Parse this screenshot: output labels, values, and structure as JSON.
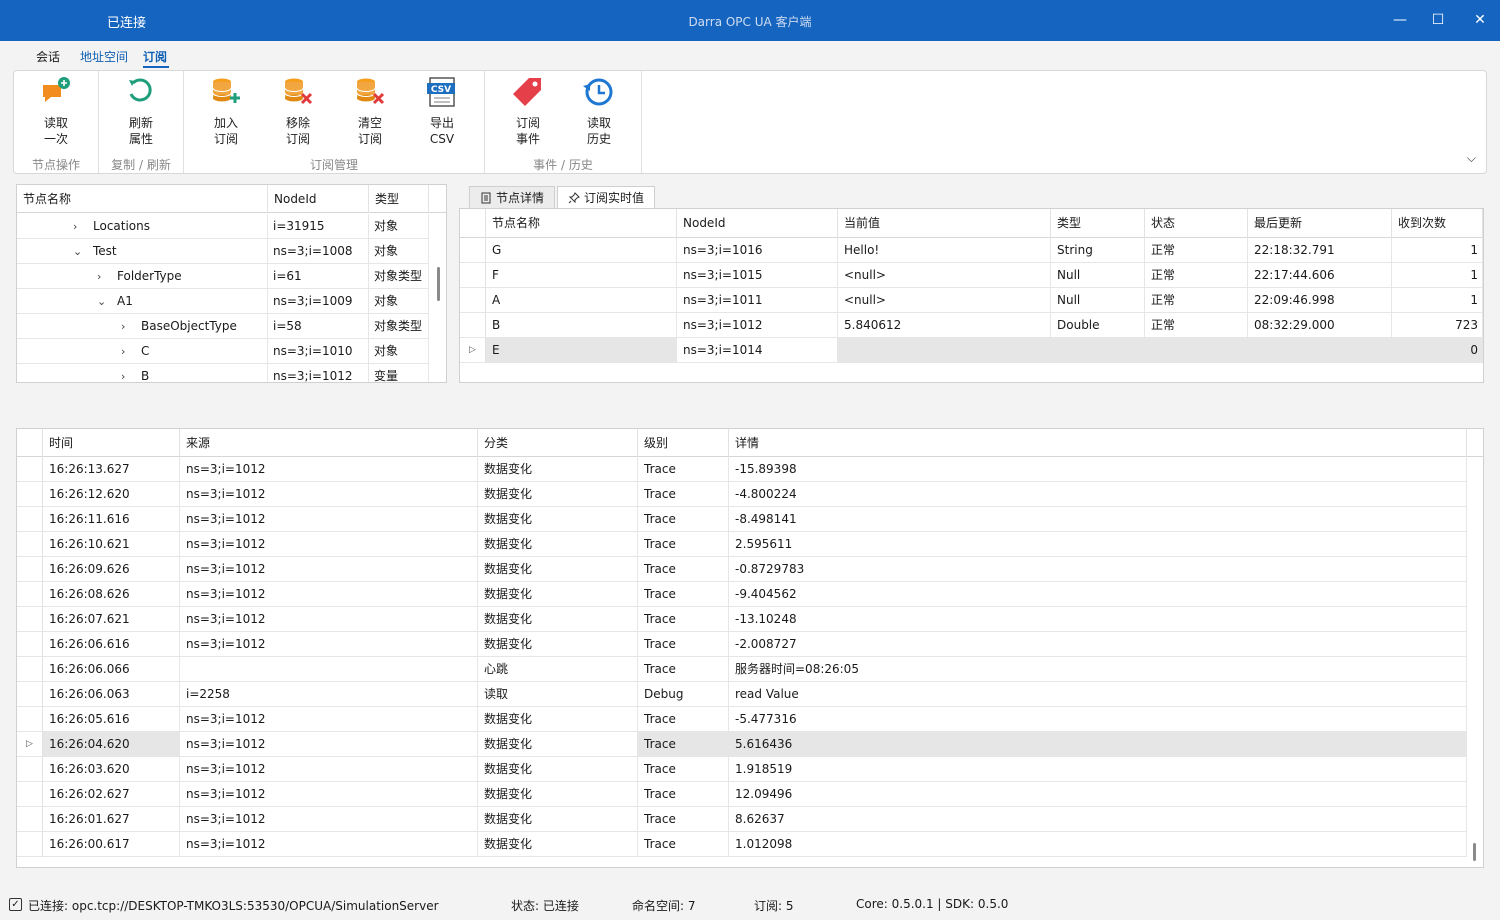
{
  "window": {
    "connection_label": "已连接",
    "title": "Darra OPC UA 客户端",
    "minimize_glyph": "—",
    "maximize_glyph": "☐",
    "close_glyph": "✕"
  },
  "ribbon_tabs": [
    "会话",
    "地址空间",
    "订阅"
  ],
  "ribbon": {
    "buttons": [
      {
        "line1": "读取",
        "line2": "一次",
        "icon": "read-once-icon"
      },
      {
        "line1": "刷新",
        "line2": "属性",
        "icon": "refresh-icon"
      },
      {
        "line1": "加入",
        "line2": "订阅",
        "icon": "db-add-icon"
      },
      {
        "line1": "移除",
        "line2": "订阅",
        "icon": "db-remove-icon"
      },
      {
        "line1": "清空",
        "line2": "订阅",
        "icon": "db-clear-icon"
      },
      {
        "line1": "导出",
        "line2": "CSV",
        "icon": "csv-icon"
      },
      {
        "line1": "订阅",
        "line2": "事件",
        "icon": "tag-icon"
      },
      {
        "line1": "读取",
        "line2": "历史",
        "icon": "history-icon"
      }
    ],
    "groups": [
      "节点操作",
      "复制 / 刷新",
      "订阅管理",
      "事件 / 历史"
    ],
    "collapse_glyph": "⌵"
  },
  "tree": {
    "headers": [
      "节点名称",
      "NodeId",
      "类型"
    ],
    "rows": [
      {
        "name": "Locations",
        "nodeid": "i=31915",
        "type": "对象",
        "toggle": "›"
      },
      {
        "name": "Test",
        "nodeid": "ns=3;i=1008",
        "type": "对象",
        "toggle": "⌄"
      },
      {
        "name": "FolderType",
        "nodeid": "i=61",
        "type": "对象类型",
        "toggle": "›"
      },
      {
        "name": "A1",
        "nodeid": "ns=3;i=1009",
        "type": "对象",
        "toggle": "⌄"
      },
      {
        "name": "BaseObjectType",
        "nodeid": "i=58",
        "type": "对象类型",
        "toggle": "›"
      },
      {
        "name": "C",
        "nodeid": "ns=3;i=1010",
        "type": "对象",
        "toggle": "›"
      },
      {
        "name": "B",
        "nodeid": "ns=3;i=1012",
        "type": "变量",
        "toggle": "›"
      }
    ]
  },
  "panel_tabs": [
    "节点详情",
    "订阅实时值"
  ],
  "subscriptions": {
    "headers": [
      "节点名称",
      "NodeId",
      "当前值",
      "类型",
      "状态",
      "最后更新",
      "收到次数"
    ],
    "rows": [
      {
        "name": "G",
        "nodeid": "ns=3;i=1016",
        "value": "Hello!",
        "type": "String",
        "status": "正常",
        "updated": "22:18:32.791",
        "count": "1"
      },
      {
        "name": "F",
        "nodeid": "ns=3;i=1015",
        "value": "<null>",
        "type": "Null",
        "status": "正常",
        "updated": "22:17:44.606",
        "count": "1"
      },
      {
        "name": "A",
        "nodeid": "ns=3;i=1011",
        "value": "<null>",
        "type": "Null",
        "status": "正常",
        "updated": "22:09:46.998",
        "count": "1"
      },
      {
        "name": "B",
        "nodeid": "ns=3;i=1012",
        "value": "5.840612",
        "type": "Double",
        "status": "正常",
        "updated": "08:32:29.000",
        "count": "723"
      },
      {
        "name": "E",
        "nodeid": "ns=3;i=1014",
        "value": "",
        "type": "",
        "status": "",
        "updated": "",
        "count": "0"
      }
    ],
    "row_marker": "▷"
  },
  "log": {
    "headers": [
      "时间",
      "来源",
      "分类",
      "级别",
      "详情"
    ],
    "rows": [
      {
        "time": "16:26:13.627",
        "source": "ns=3;i=1012",
        "category": "数据变化",
        "level": "Trace",
        "detail": "-15.89398"
      },
      {
        "time": "16:26:12.620",
        "source": "ns=3;i=1012",
        "category": "数据变化",
        "level": "Trace",
        "detail": "-4.800224"
      },
      {
        "time": "16:26:11.616",
        "source": "ns=3;i=1012",
        "category": "数据变化",
        "level": "Trace",
        "detail": "-8.498141"
      },
      {
        "time": "16:26:10.621",
        "source": "ns=3;i=1012",
        "category": "数据变化",
        "level": "Trace",
        "detail": "2.595611"
      },
      {
        "time": "16:26:09.626",
        "source": "ns=3;i=1012",
        "category": "数据变化",
        "level": "Trace",
        "detail": "-0.8729783"
      },
      {
        "time": "16:26:08.626",
        "source": "ns=3;i=1012",
        "category": "数据变化",
        "level": "Trace",
        "detail": "-9.404562"
      },
      {
        "time": "16:26:07.621",
        "source": "ns=3;i=1012",
        "category": "数据变化",
        "level": "Trace",
        "detail": "-13.10248"
      },
      {
        "time": "16:26:06.616",
        "source": "ns=3;i=1012",
        "category": "数据变化",
        "level": "Trace",
        "detail": "-2.008727"
      },
      {
        "time": "16:26:06.066",
        "source": "",
        "category": "心跳",
        "level": "Trace",
        "detail": "服务器时间=08:26:05"
      },
      {
        "time": "16:26:06.063",
        "source": "i=2258",
        "category": "读取",
        "level": "Debug",
        "detail": "read Value"
      },
      {
        "time": "16:26:05.616",
        "source": "ns=3;i=1012",
        "category": "数据变化",
        "level": "Trace",
        "detail": "-5.477316"
      },
      {
        "time": "16:26:04.620",
        "source": "ns=3;i=1012",
        "category": "数据变化",
        "level": "Trace",
        "detail": "5.616436"
      },
      {
        "time": "16:26:03.620",
        "source": "ns=3;i=1012",
        "category": "数据变化",
        "level": "Trace",
        "detail": "1.918519"
      },
      {
        "time": "16:26:02.627",
        "source": "ns=3;i=1012",
        "category": "数据变化",
        "level": "Trace",
        "detail": "12.09496"
      },
      {
        "time": "16:26:01.627",
        "source": "ns=3;i=1012",
        "category": "数据变化",
        "level": "Trace",
        "detail": "8.62637"
      },
      {
        "time": "16:26:00.617",
        "source": "ns=3;i=1012",
        "category": "数据变化",
        "level": "Trace",
        "detail": "1.012098"
      }
    ]
  },
  "statusbar": {
    "connection": "已连接: opc.tcp://DESKTOP-TMKO3LS:53530/OPCUA/SimulationServer",
    "state": "状态: 已连接",
    "namespaces": "命名空间: 7",
    "subscriptions": "订阅: 5",
    "versions": "Core: 0.5.0.1  |  SDK: 0.5.0",
    "check_glyph": "✓"
  },
  "colors": {
    "accent": "#1565c0",
    "tab_active": "#0f5fb3",
    "selected_row": "#e6e6e6"
  }
}
